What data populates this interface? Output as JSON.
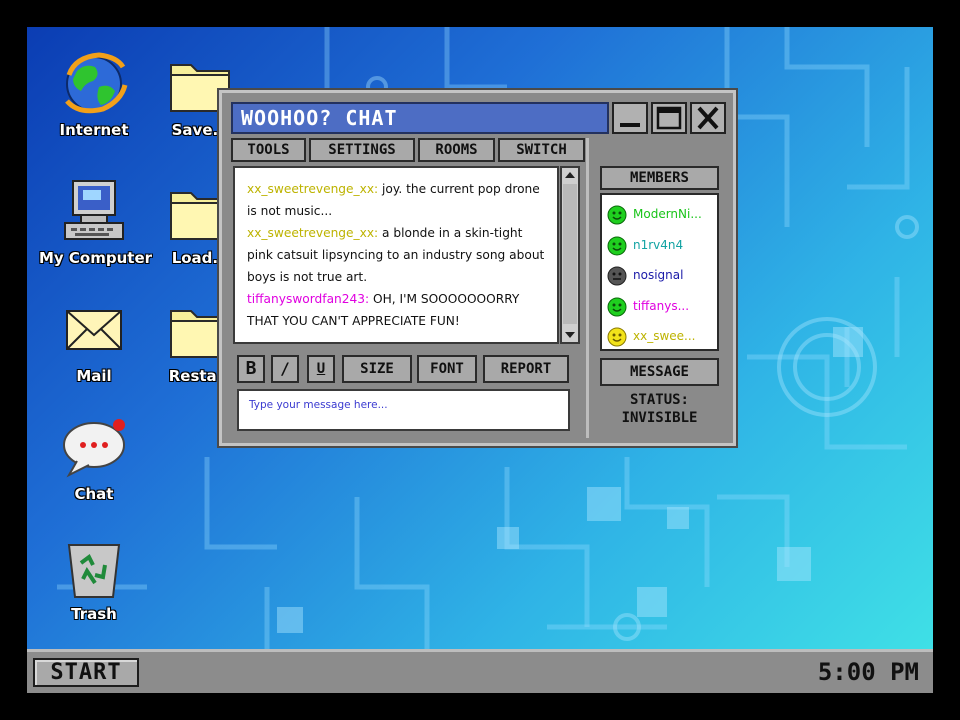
{
  "desktop": {
    "icons": [
      {
        "label": "Internet",
        "icon": "internet-globe-icon"
      },
      {
        "label": "Save.e",
        "icon": "folder-icon"
      },
      {
        "label": "My Computer",
        "icon": "computer-icon"
      },
      {
        "label": "Load.e",
        "icon": "folder-icon"
      },
      {
        "label": "Mail",
        "icon": "envelope-icon"
      },
      {
        "label": "Restart",
        "icon": "folder-icon"
      },
      {
        "label": "Chat",
        "icon": "speech-bubble-icon"
      },
      {
        "label": "Trash",
        "icon": "recycle-bin-icon"
      }
    ]
  },
  "taskbar": {
    "start_label": "START",
    "clock": "5:00 PM"
  },
  "chat": {
    "title": "WOOHOO? CHAT",
    "menu": [
      "TOOLS",
      "SETTINGS",
      "ROOMS",
      "SWITCH"
    ],
    "messages": [
      {
        "user": "xx_sweetrevenge_xx:",
        "text": " joy. the current pop drone is not music..."
      },
      {
        "user": "xx_sweetrevenge_xx:",
        "text": " a blonde in a skin-tight pink catsuit lipsyncing to an industry song about boys is not true art."
      },
      {
        "user": "tiffanyswordfan243:",
        "text": " OH, I'M SOOOOOOORRY THAT YOU CAN'T APPRECIATE FUN!"
      }
    ],
    "format_buttons": {
      "bold": "B",
      "italic": "/",
      "underline": "U",
      "size": "SIZE",
      "font": "FONT",
      "report": "REPORT"
    },
    "input_placeholder": "Type your message here...",
    "members_header": "MEMBERS",
    "members": [
      {
        "name": "ModernNi...",
        "color": "#19c419",
        "status": "online"
      },
      {
        "name": "n1rv4n4",
        "color": "#12a3a3",
        "status": "online"
      },
      {
        "name": "nosignal",
        "color": "#1a1aa8",
        "status": "offline"
      },
      {
        "name": "tiffanys...",
        "color": "#e000e0",
        "status": "online"
      },
      {
        "name": "xx_swee...",
        "color": "#bdb300",
        "status": "away"
      }
    ],
    "message_button": "MESSAGE",
    "status_label": "STATUS:",
    "status_value": "INVISIBLE"
  },
  "colors": {
    "title_bar": "#4d6dc4",
    "window_gray": "#8a8a8a",
    "online": "#1fcf1f",
    "offline": "#555555",
    "away": "#f2e21a"
  }
}
